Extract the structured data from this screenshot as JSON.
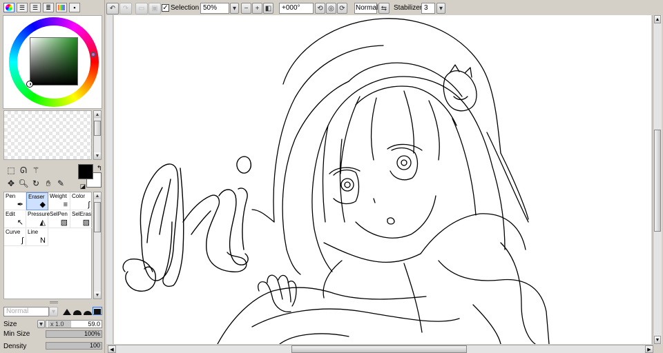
{
  "toolbar": {
    "selection_label": "Selection",
    "zoom_value": "50%",
    "rotation_value": "+000°",
    "blend_mode": "Normal",
    "stabilizer_label": "Stabilizer",
    "stabilizer_value": "3"
  },
  "brushes": [
    {
      "name": "Pen",
      "icon": "pen-icon"
    },
    {
      "name": "Eraser",
      "icon": "eraser-icon"
    },
    {
      "name": "Weight",
      "icon": "weight-icon"
    },
    {
      "name": "Color",
      "icon": "color-icon"
    },
    {
      "name": "Edit",
      "icon": "edit-icon"
    },
    {
      "name": "Pressure",
      "icon": "pressure-icon"
    },
    {
      "name": "SelPen",
      "icon": "selpen-icon"
    },
    {
      "name": "SelEras",
      "icon": "seleras-icon"
    },
    {
      "name": "Curve",
      "icon": "curve-icon"
    },
    {
      "name": "Line",
      "icon": "line-icon"
    }
  ],
  "selected_brush": "Eraser",
  "brush_props": {
    "mode_placeholder": "Normal",
    "size_label": "Size",
    "size_multiplier": "x 1.0",
    "size_value": "59.0",
    "min_size_label": "Min Size",
    "min_size_value": "100%",
    "min_size_level": 1.0,
    "density_label": "Density",
    "density_value": "100",
    "density_level": 1.0
  },
  "colors": {
    "foreground": "#000000",
    "background": "#ffffff",
    "accent": "#3a6fd8"
  }
}
